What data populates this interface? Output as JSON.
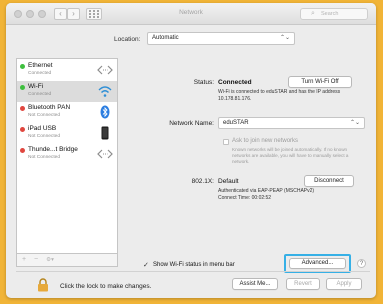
{
  "window": {
    "title": "Network",
    "search_placeholder": "Search"
  },
  "location": {
    "label": "Location:",
    "value": "Automatic"
  },
  "services": [
    {
      "name": "Ethernet",
      "status": "Connected",
      "icon": "ethernet-arrows-icon",
      "color": "#3fbf3f"
    },
    {
      "name": "Wi-Fi",
      "status": "Connected",
      "icon": "wifi-icon",
      "color": "#3fbf3f"
    },
    {
      "name": "Bluetooth PAN",
      "status": "Not Connected",
      "icon": "bluetooth-icon",
      "color": "#e0473f"
    },
    {
      "name": "iPad USB",
      "status": "Not Connected",
      "icon": "ipad-icon",
      "color": "#e0473f"
    },
    {
      "name": "Thunde...t Bridge",
      "status": "Not Connected",
      "icon": "thunderbolt-arrows-icon",
      "color": "#e0473f"
    }
  ],
  "sidebar_toolbar": {
    "add": "+",
    "remove": "−",
    "gear": "⚙▾"
  },
  "status": {
    "label": "Status:",
    "value": "Connected",
    "button": "Turn Wi-Fi Off",
    "note": "Wi-Fi is connected to eduSTAR and has the IP address 10.178.81.176."
  },
  "network_name": {
    "label": "Network Name:",
    "value": "eduSTAR",
    "ask_label": "Ask to join new networks",
    "ask_note": "Known networks will be joined automatically. If no known networks are available, you will have to manually select a network."
  },
  "dot1x": {
    "label": "802.1X:",
    "value": "Default",
    "button": "Disconnect",
    "note1": "Authenticated via EAP-PEAP (MSCHAPv2)",
    "note2": "Connect Time: 00:02:52"
  },
  "show_wifi": {
    "label": "Show Wi-Fi status in menu bar",
    "checked": true
  },
  "buttons": {
    "advanced": "Advanced...",
    "help": "?",
    "assist": "Assist Me...",
    "revert": "Revert",
    "apply": "Apply"
  },
  "lock_text": "Click the lock to make changes.",
  "colors": {
    "accent": "#36b0e6",
    "frame": "#f1b437"
  }
}
